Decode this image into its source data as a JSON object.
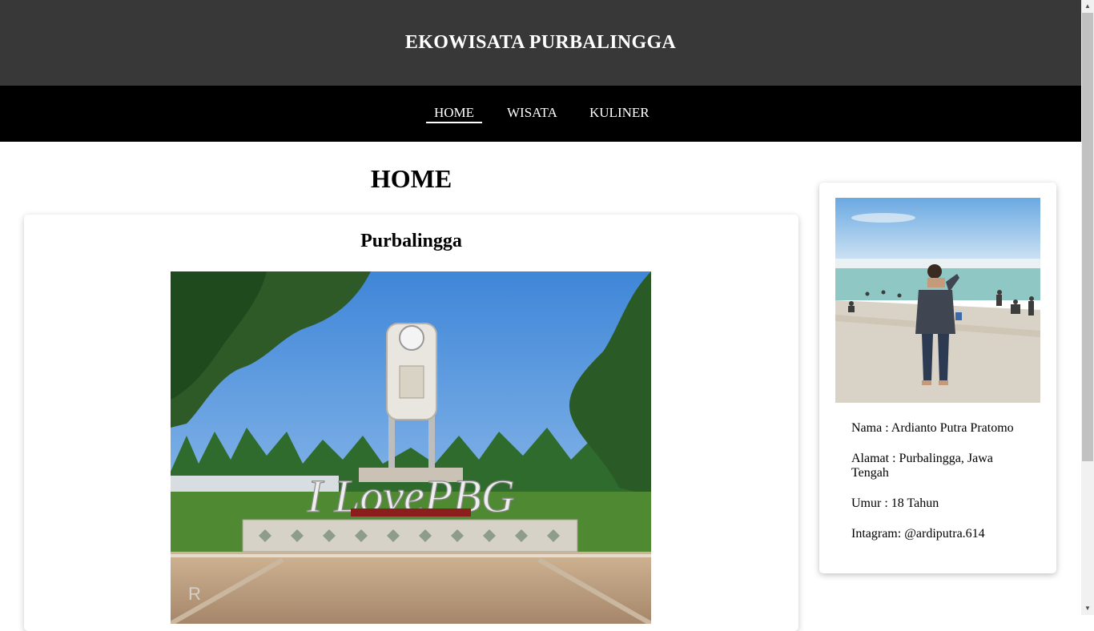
{
  "header": {
    "title": "EKOWISATA PURBALINGGA"
  },
  "nav": {
    "items": [
      {
        "label": "HOME",
        "active": true
      },
      {
        "label": "WISATA",
        "active": false
      },
      {
        "label": "KULINER",
        "active": false
      }
    ]
  },
  "main": {
    "page_title": "HOME",
    "card": {
      "title": "Purbalingga",
      "image": {
        "sign_text": "I LovePBG"
      }
    }
  },
  "sidebar": {
    "profile": {
      "name": "Nama : Ardianto Putra Pratomo",
      "address": "Alamat : Purbalingga, Jawa Tengah",
      "age": "Umur : 18 Tahun",
      "instagram": "Intagram: @ardiputra.614"
    }
  },
  "colors": {
    "header_bg": "#383838",
    "nav_bg": "#000000",
    "page_bg": "#ffffff"
  },
  "icons": {
    "scroll_up": "arrow-up-icon",
    "scroll_down": "arrow-down-icon"
  }
}
